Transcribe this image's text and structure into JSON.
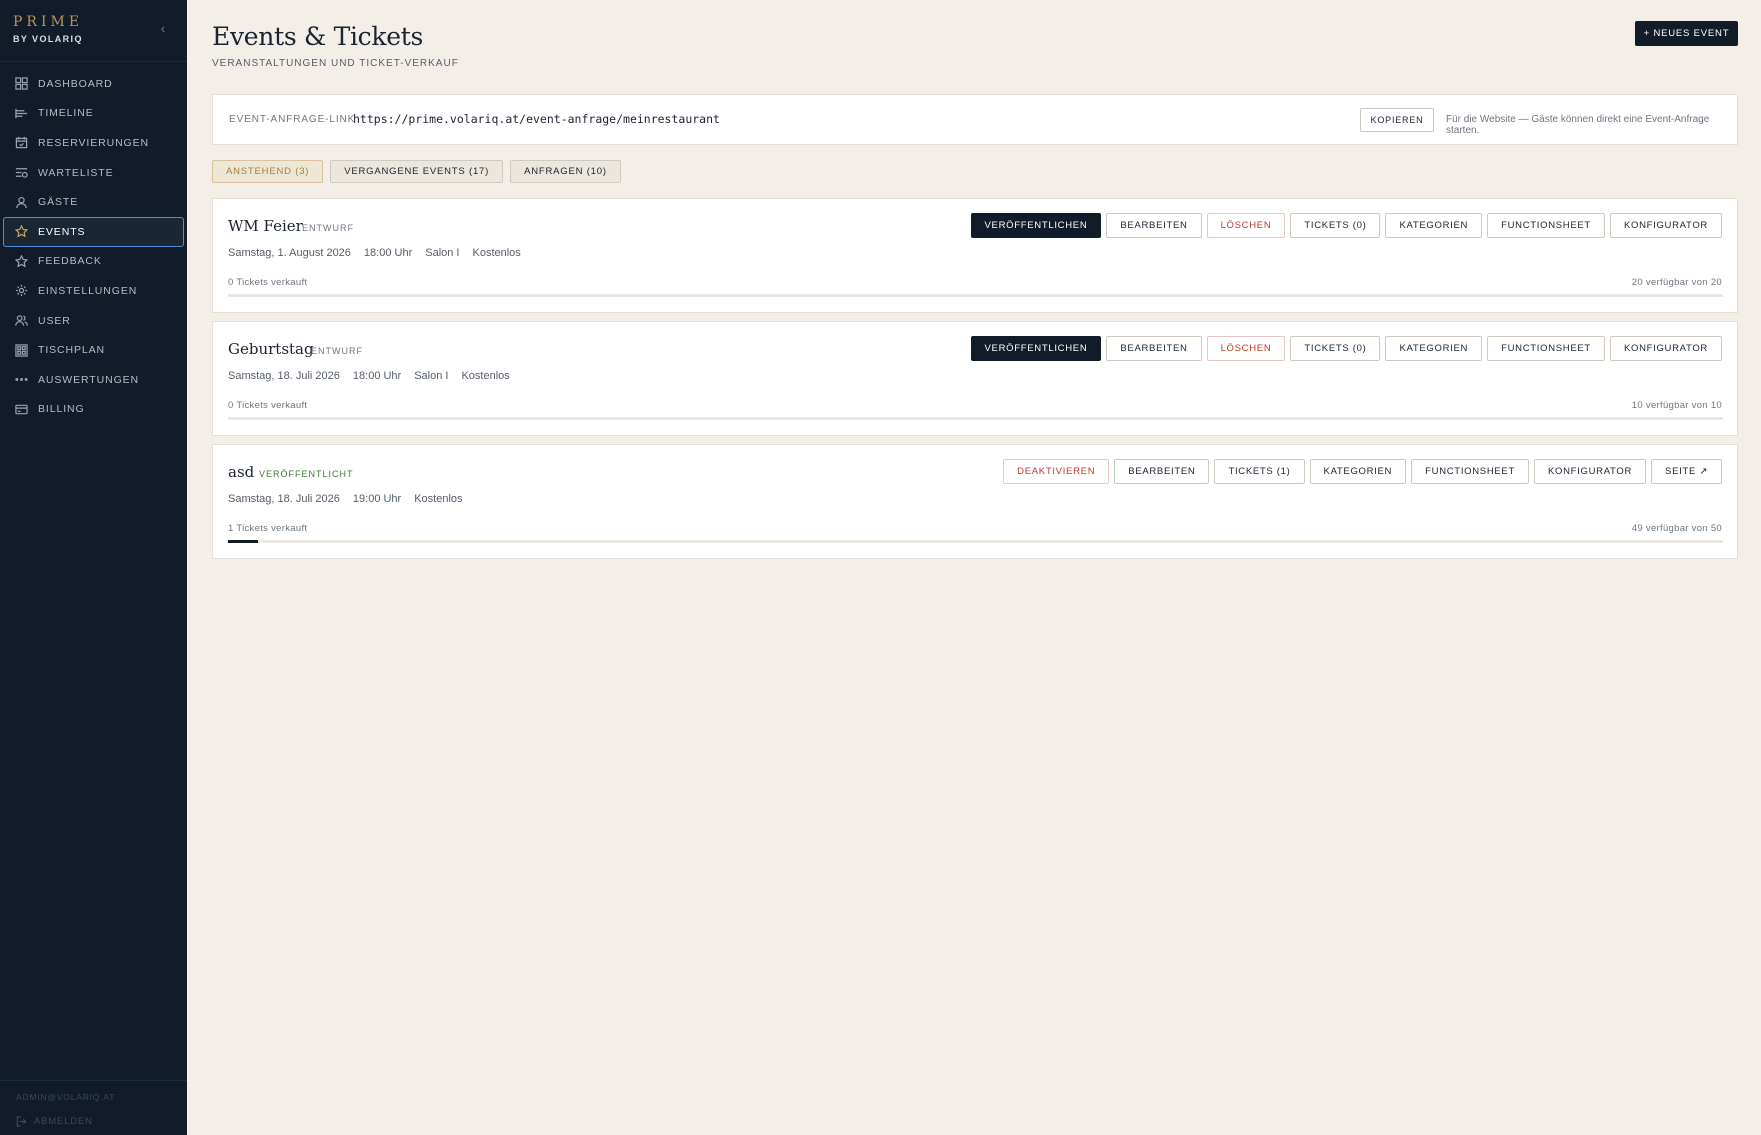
{
  "brand": {
    "name": "PRIME",
    "sub": "BY VOLARIQ"
  },
  "sidebar": {
    "collapse": "‹",
    "items": [
      {
        "label": "DASHBOARD",
        "icon": "grid-icon"
      },
      {
        "label": "TIMELINE",
        "icon": "timeline-icon"
      },
      {
        "label": "RESERVIERUNGEN",
        "icon": "calendar-icon"
      },
      {
        "label": "WARTELISTE",
        "icon": "waitlist-icon"
      },
      {
        "label": "GÄSTE",
        "icon": "user-icon"
      },
      {
        "label": "EVENTS",
        "icon": "star-icon",
        "active": true
      },
      {
        "label": "FEEDBACK",
        "icon": "star-outline-icon"
      },
      {
        "label": "EINSTELLUNGEN",
        "icon": "gear-icon"
      },
      {
        "label": "USER",
        "icon": "users-icon"
      },
      {
        "label": "TISCHPLAN",
        "icon": "floorplan-icon"
      },
      {
        "label": "AUSWERTUNGEN",
        "icon": "dots-icon"
      },
      {
        "label": "BILLING",
        "icon": "card-icon"
      }
    ],
    "email": "ADMIN@VOLARIQ.AT",
    "logout": "ABMELDEN"
  },
  "header": {
    "title": "Events & Tickets",
    "subtitle": "VERANSTALTUNGEN UND TICKET-VERKAUF",
    "new_event": "+ NEUES EVENT"
  },
  "link_bar": {
    "label": "EVENT-ANFRAGE-LINK",
    "url": "https://prime.volariq.at/event-anfrage/meinrestaurant",
    "copy": "KOPIEREN",
    "hint": "Für die Website — Gäste können direkt eine Event-Anfrage starten."
  },
  "tabs": [
    {
      "label": "ANSTEHEND (3)",
      "active": true
    },
    {
      "label": "VERGANGENE EVENTS (17)"
    },
    {
      "label": "ANFRAGEN (10)"
    }
  ],
  "events": [
    {
      "title": "WM Feier",
      "status": "ENTWURF",
      "date": "Samstag, 1. August 2026",
      "time": "18:00 Uhr",
      "room": "Salon I",
      "price": "Kostenlos",
      "actions": [
        "VERÖFFENTLICHEN",
        "BEARBEITEN",
        "LÖSCHEN",
        "TICKETS (0)",
        "KATEGORIEN",
        "FUNCTIONSHEET",
        "KONFIGURATOR"
      ],
      "sold": "0 Tickets verkauft",
      "available": "20 verfügbar von 20",
      "progress": 0
    },
    {
      "title": "Geburtstag",
      "status": "ENTWURF",
      "date": "Samstag, 18. Juli 2026",
      "time": "18:00 Uhr",
      "room": "Salon I",
      "price": "Kostenlos",
      "actions": [
        "VERÖFFENTLICHEN",
        "BEARBEITEN",
        "LÖSCHEN",
        "TICKETS (0)",
        "KATEGORIEN",
        "FUNCTIONSHEET",
        "KONFIGURATOR"
      ],
      "sold": "0 Tickets verkauft",
      "available": "10 verfügbar von 10",
      "progress": 0
    },
    {
      "title": "asd",
      "status": "VERÖFFENTLICHT",
      "date": "Samstag, 18. Juli 2026",
      "time": "19:00 Uhr",
      "price": "Kostenlos",
      "actions": [
        "DEAKTIVIEREN",
        "BEARBEITEN",
        "TICKETS (1)",
        "KATEGORIEN",
        "FUNCTIONSHEET",
        "KONFIGURATOR",
        "SEITE ↗"
      ],
      "sold": "1 Tickets verkauft",
      "available": "49 verfügbar von 50",
      "progress": 0.02
    }
  ]
}
